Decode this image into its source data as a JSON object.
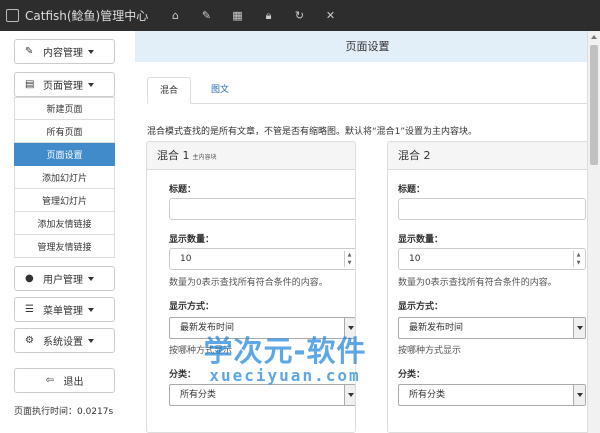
{
  "header": {
    "title": "Catfish(鲶鱼)管理中心",
    "nav_icons": [
      "home-icon",
      "pencil-icon",
      "calculator-icon",
      "lock-icon",
      "refresh-icon",
      "close-icon"
    ]
  },
  "sidebar": {
    "menus": [
      {
        "label": "内容管理",
        "icon": "edit-icon"
      },
      {
        "label": "页面管理",
        "icon": "file-icon"
      },
      {
        "label": "用户管理",
        "icon": "user-icon"
      },
      {
        "label": "菜单管理",
        "icon": "list-icon"
      },
      {
        "label": "系统设置",
        "icon": "gear-icon"
      }
    ],
    "page_sub": [
      "新建页面",
      "所有页面",
      "页面设置",
      "添加幻灯片",
      "管理幻灯片",
      "添加友情链接",
      "管理友情链接"
    ],
    "active_sub": "页面设置",
    "logout": "退出",
    "exec_time": "页面执行时间：0.0217s"
  },
  "main": {
    "heading": "页面设置",
    "tabs": [
      "混合",
      "图文"
    ],
    "hint": "混合模式查找的是所有文章，不管是否有缩略图。默认将“混合1”设置为主内容块。",
    "panels": [
      {
        "title": "混合 1",
        "subtitle": "主内容块",
        "title_label": "标题：",
        "title_value": "",
        "count_label": "显示数量：",
        "count_value": "10",
        "count_help": "数量为0表示查找所有符合条件的内容。",
        "mode_label": "显示方式：",
        "mode_value": "最新发布时间",
        "mode_help": "按哪种方式显示",
        "category_label": "分类：",
        "category_value": "所有分类"
      },
      {
        "title": "混合 2",
        "subtitle": "",
        "title_label": "标题：",
        "title_value": "",
        "count_label": "显示数量：",
        "count_value": "10",
        "count_help": "数量为0表示查找所有符合条件的内容。",
        "mode_label": "显示方式：",
        "mode_value": "最新发布时间",
        "mode_help": "按哪种方式显示",
        "category_label": "分类：",
        "category_value": "所有分类"
      }
    ]
  },
  "watermark": {
    "line1": "学次元-软件",
    "line2": "xueciyuan.com"
  },
  "colors": {
    "topbar": "#2d2d2d",
    "active": "#428bca",
    "header_band": "#e2eef8",
    "link": "#2a6fb6"
  }
}
